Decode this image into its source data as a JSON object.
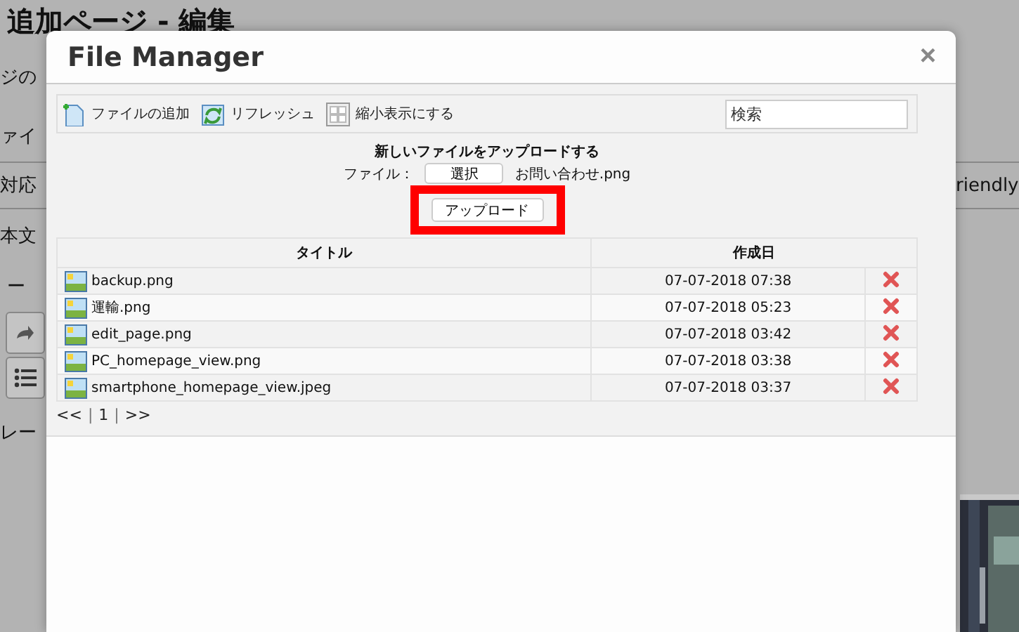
{
  "background_page": {
    "title": "追加ページ - 編集",
    "left_fragments": [
      {
        "kind": "text",
        "text": "ジの"
      },
      {
        "kind": "text",
        "text": "ァイ"
      },
      {
        "kind": "text",
        "text": "対応"
      },
      {
        "kind": "text",
        "text": "本文"
      },
      {
        "kind": "text",
        "text": "ー"
      },
      {
        "kind": "redo"
      },
      {
        "kind": "list"
      },
      {
        "kind": "text",
        "text": "レー"
      }
    ],
    "right_text": "riendly"
  },
  "dialog": {
    "title": "File Manager",
    "close": "×",
    "toolbar": [
      {
        "kind": "add",
        "label": "ファイルの追加"
      },
      {
        "kind": "refresh",
        "label": "リフレッシュ"
      },
      {
        "kind": "thumbnails",
        "label": "縮小表示にする"
      }
    ],
    "search": {
      "placeholder": "検索"
    },
    "upload": {
      "heading": "新しいファイルをアップロードする",
      "file_label": "ファイル：",
      "choose_button": "選択",
      "file_name": "お問い合わせ.png",
      "upload_button": "アップロード",
      "highlighted": true
    },
    "table": {
      "columns": [
        "タイトル",
        "作成日"
      ],
      "rows": [
        {
          "title": "backup.png",
          "created": "07-07-2018 07:38"
        },
        {
          "title": "運輸.png",
          "created": "07-07-2018 05:23"
        },
        {
          "title": "edit_page.png",
          "created": "07-07-2018 03:42"
        },
        {
          "title": "PC_homepage_view.png",
          "created": "07-07-2018 03:38"
        },
        {
          "title": "smartphone_homepage_view.jpeg",
          "created": "07-07-2018 03:37"
        }
      ]
    },
    "pager": [
      {
        "kind": "link",
        "text": "<<"
      },
      {
        "kind": "separator",
        "text": "|"
      },
      {
        "kind": "link",
        "text": "1"
      },
      {
        "kind": "separator",
        "text": "|"
      },
      {
        "kind": "link",
        "text": ">>"
      }
    ]
  }
}
